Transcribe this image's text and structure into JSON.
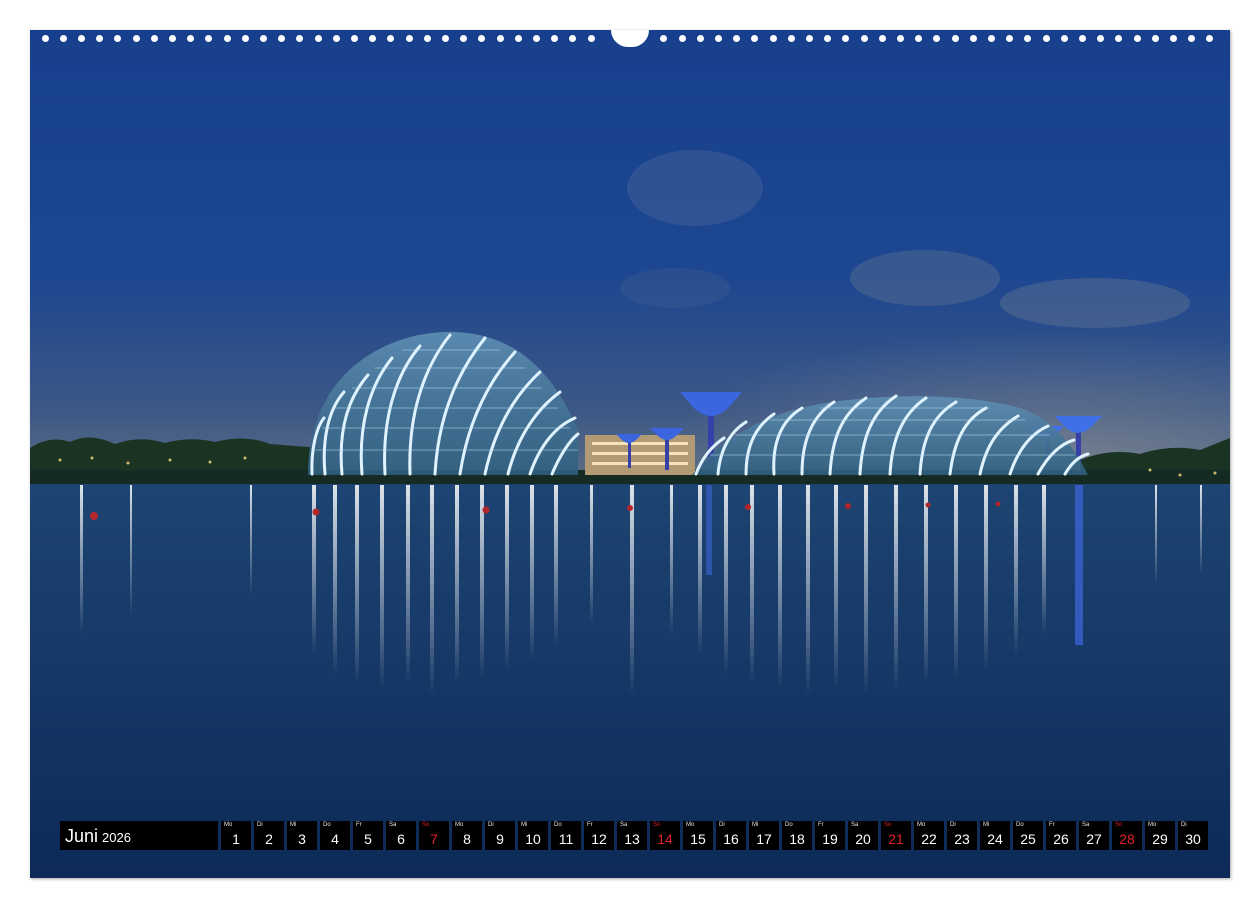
{
  "colors": {
    "sky_top": "#173f8d",
    "sky_horizon": "#5d6f86",
    "water": "#10315f",
    "bar_bg": "#000000",
    "sunday": "#e0202a"
  },
  "calendar": {
    "month": "Juni",
    "year": "2026",
    "days": [
      {
        "dow": "Mo",
        "num": "1",
        "sunday": false
      },
      {
        "dow": "Di",
        "num": "2",
        "sunday": false
      },
      {
        "dow": "Mi",
        "num": "3",
        "sunday": false
      },
      {
        "dow": "Do",
        "num": "4",
        "sunday": false
      },
      {
        "dow": "Fr",
        "num": "5",
        "sunday": false
      },
      {
        "dow": "Sa",
        "num": "6",
        "sunday": false
      },
      {
        "dow": "So",
        "num": "7",
        "sunday": true
      },
      {
        "dow": "Mo",
        "num": "8",
        "sunday": false
      },
      {
        "dow": "Di",
        "num": "9",
        "sunday": false
      },
      {
        "dow": "Mi",
        "num": "10",
        "sunday": false
      },
      {
        "dow": "Do",
        "num": "11",
        "sunday": false
      },
      {
        "dow": "Fr",
        "num": "12",
        "sunday": false
      },
      {
        "dow": "Sa",
        "num": "13",
        "sunday": false
      },
      {
        "dow": "So",
        "num": "14",
        "sunday": true
      },
      {
        "dow": "Mo",
        "num": "15",
        "sunday": false
      },
      {
        "dow": "Di",
        "num": "16",
        "sunday": false
      },
      {
        "dow": "Mi",
        "num": "17",
        "sunday": false
      },
      {
        "dow": "Do",
        "num": "18",
        "sunday": false
      },
      {
        "dow": "Fr",
        "num": "19",
        "sunday": false
      },
      {
        "dow": "Sa",
        "num": "20",
        "sunday": false
      },
      {
        "dow": "So",
        "num": "21",
        "sunday": true
      },
      {
        "dow": "Mo",
        "num": "22",
        "sunday": false
      },
      {
        "dow": "Di",
        "num": "23",
        "sunday": false
      },
      {
        "dow": "Mi",
        "num": "24",
        "sunday": false
      },
      {
        "dow": "Do",
        "num": "25",
        "sunday": false
      },
      {
        "dow": "Fr",
        "num": "26",
        "sunday": false
      },
      {
        "dow": "Sa",
        "num": "27",
        "sunday": false
      },
      {
        "dow": "So",
        "num": "28",
        "sunday": true
      },
      {
        "dow": "Mo",
        "num": "29",
        "sunday": false
      },
      {
        "dow": "Di",
        "num": "30",
        "sunday": false
      }
    ]
  }
}
